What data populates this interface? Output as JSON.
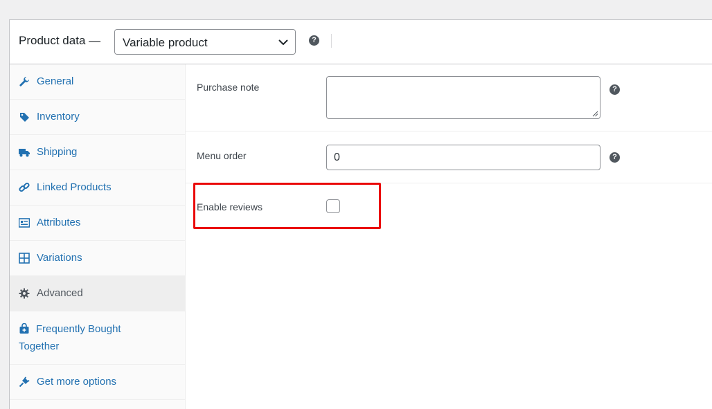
{
  "header": {
    "title": "Product data —",
    "product_type": "Variable product",
    "help": "?"
  },
  "sidebar": {
    "items": [
      {
        "label": "General",
        "icon": "wrench-icon"
      },
      {
        "label": "Inventory",
        "icon": "tag-icon"
      },
      {
        "label": "Shipping",
        "icon": "truck-icon"
      },
      {
        "label": "Linked Products",
        "icon": "link-icon"
      },
      {
        "label": "Attributes",
        "icon": "list-card-icon"
      },
      {
        "label": "Variations",
        "icon": "grid-icon"
      },
      {
        "label": "Advanced",
        "icon": "gear-icon",
        "active": true
      },
      {
        "label": "Frequently Bought Together",
        "icon": "bag-icon"
      },
      {
        "label": "Get more options",
        "icon": "plug-icon"
      }
    ]
  },
  "fields": {
    "purchase_note": {
      "label": "Purchase note",
      "value": ""
    },
    "menu_order": {
      "label": "Menu order",
      "value": "0"
    },
    "enable_reviews": {
      "label": "Enable reviews",
      "checked": false
    }
  },
  "colors": {
    "link": "#2271b1",
    "highlight": "#ea0a0a"
  }
}
